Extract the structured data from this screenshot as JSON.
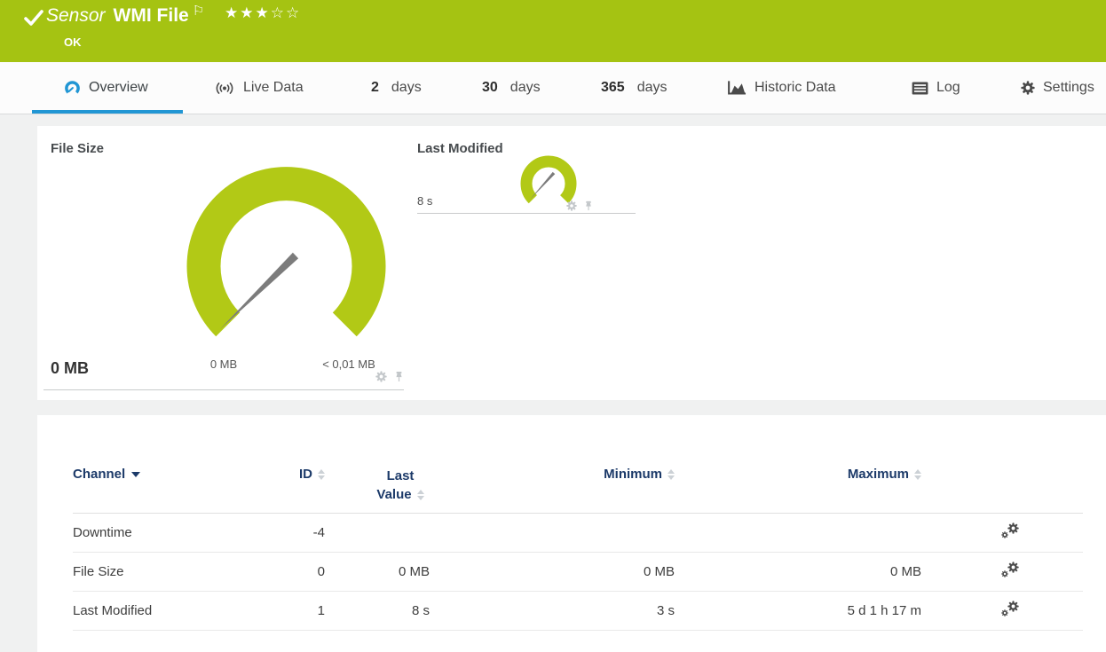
{
  "header": {
    "category": "Sensor",
    "title": "WMI File",
    "status": "OK",
    "rating_filled": "★★★",
    "rating_empty": "☆☆"
  },
  "tabs": [
    {
      "label": "Overview",
      "active": true
    },
    {
      "label": "Live Data"
    },
    {
      "number": "2",
      "label": "days"
    },
    {
      "number": "30",
      "label": "days"
    },
    {
      "number": "365",
      "label": "days"
    },
    {
      "label": "Historic Data"
    },
    {
      "label": "Log"
    },
    {
      "label": "Settings"
    }
  ],
  "gauges": {
    "file_size": {
      "title": "File Size",
      "value": "0 MB",
      "min_label": "0 MB",
      "max_label": "< 0,01 MB"
    },
    "last_modified": {
      "title": "Last Modified",
      "value": "8 s"
    }
  },
  "table": {
    "columns": [
      "Channel",
      "ID",
      "Last Value",
      "Minimum",
      "Maximum"
    ],
    "rows": [
      {
        "channel": "Downtime",
        "id": "-4",
        "last_value": "",
        "minimum": "",
        "maximum": ""
      },
      {
        "channel": "File Size",
        "id": "0",
        "last_value": "0 MB",
        "minimum": "0 MB",
        "maximum": "0 MB"
      },
      {
        "channel": "Last Modified",
        "id": "1",
        "last_value": "8 s",
        "minimum": "3 s",
        "maximum": "5 d 1 h 17 m"
      }
    ]
  },
  "colors": {
    "header_green": "#a5c312",
    "gauge_green": "#b2c916",
    "needle_gray": "#7c7c7c",
    "tab_active_blue": "#2196d4",
    "table_header_navy": "#1c3a69"
  }
}
